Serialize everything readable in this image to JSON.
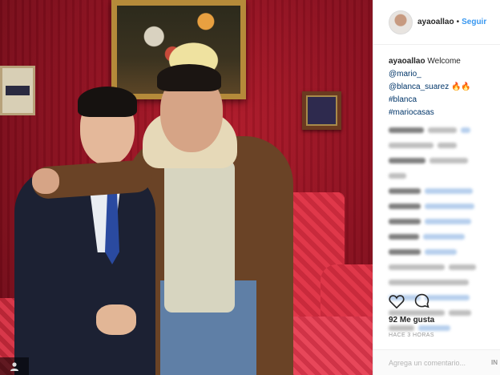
{
  "post": {
    "username": "ayaoallao",
    "separator": "•",
    "follow_label": "Seguir",
    "caption": {
      "author": "ayaoallao",
      "text_welcome": "Welcome",
      "mentions": [
        "@mario_",
        "@blanca_suarez"
      ],
      "emoji": "🔥🔥",
      "hashtags": [
        "#blanca",
        "#mariocasas"
      ]
    },
    "likes_text": "92 Me gusta",
    "time_text": "HACE 3 HORAS",
    "comment_placeholder": "Agrega un comentario...",
    "post_label": "IN"
  },
  "icons": {
    "like": "heart-icon",
    "comment": "comment-bubble-icon",
    "person": "person-icon"
  },
  "colors": {
    "link_blue": "#3897f0",
    "mention_blue": "#003569",
    "curtain_red": "#8e1020"
  }
}
